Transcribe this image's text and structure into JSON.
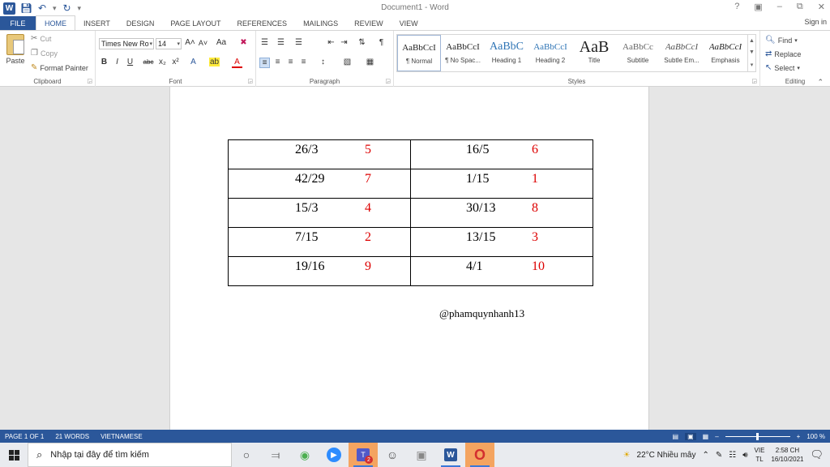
{
  "app": {
    "title": "Document1 - Word",
    "sign_in": "Sign in"
  },
  "tabs": [
    "FILE",
    "HOME",
    "INSERT",
    "DESIGN",
    "PAGE LAYOUT",
    "REFERENCES",
    "MAILINGS",
    "REVIEW",
    "VIEW"
  ],
  "ribbon": {
    "clipboard": {
      "paste": "Paste",
      "cut": "Cut",
      "copy": "Copy",
      "format_painter": "Format Painter",
      "label": "Clipboard"
    },
    "font": {
      "family": "Times New Ro",
      "size": "14",
      "label": "Font"
    },
    "paragraph": {
      "label": "Paragraph"
    },
    "styles": {
      "label": "Styles",
      "items": [
        {
          "preview": "AaBbCcI",
          "name": "¶ Normal"
        },
        {
          "preview": "AaBbCcI",
          "name": "¶ No Spac..."
        },
        {
          "preview": "AaBbC",
          "name": "Heading 1"
        },
        {
          "preview": "AaBbCcI",
          "name": "Heading 2"
        },
        {
          "preview": "AaB",
          "name": "Title"
        },
        {
          "preview": "AaBbCc",
          "name": "Subtitle"
        },
        {
          "preview": "AaBbCcI",
          "name": "Subtle Em..."
        },
        {
          "preview": "AaBbCcI",
          "name": "Emphasis"
        }
      ]
    },
    "editing": {
      "find": "Find",
      "replace": "Replace",
      "select": "Select",
      "label": "Editing"
    }
  },
  "document": {
    "table": [
      [
        {
          "fraction": "26/3",
          "number": "5"
        },
        {
          "fraction": "16/5",
          "number": "6"
        }
      ],
      [
        {
          "fraction": "42/29",
          "number": "7"
        },
        {
          "fraction": "1/15",
          "number": "1"
        }
      ],
      [
        {
          "fraction": "15/3",
          "number": "4"
        },
        {
          "fraction": "30/13",
          "number": "8"
        }
      ],
      [
        {
          "fraction": "7/15",
          "number": "2"
        },
        {
          "fraction": "13/15",
          "number": "3"
        }
      ],
      [
        {
          "fraction": "19/16",
          "number": "9"
        },
        {
          "fraction": "4/1",
          "number": "10"
        }
      ]
    ],
    "signature": "@phamquynhanh13"
  },
  "status": {
    "page": "PAGE 1 OF 1",
    "words": "21 WORDS",
    "language": "VIETNAMESE",
    "zoom": "100 %"
  },
  "taskbar": {
    "search_placeholder": "Nhập tại đây để tìm kiếm",
    "teams_badge": "2",
    "weather": "22°C  Nhiều mây",
    "lang_top": "VIE",
    "lang_bottom": "TL",
    "time": "2:58 CH",
    "date": "16/10/2021"
  },
  "colors": {
    "word_blue": "#2b579a",
    "red_numbers": "#dd0000"
  }
}
